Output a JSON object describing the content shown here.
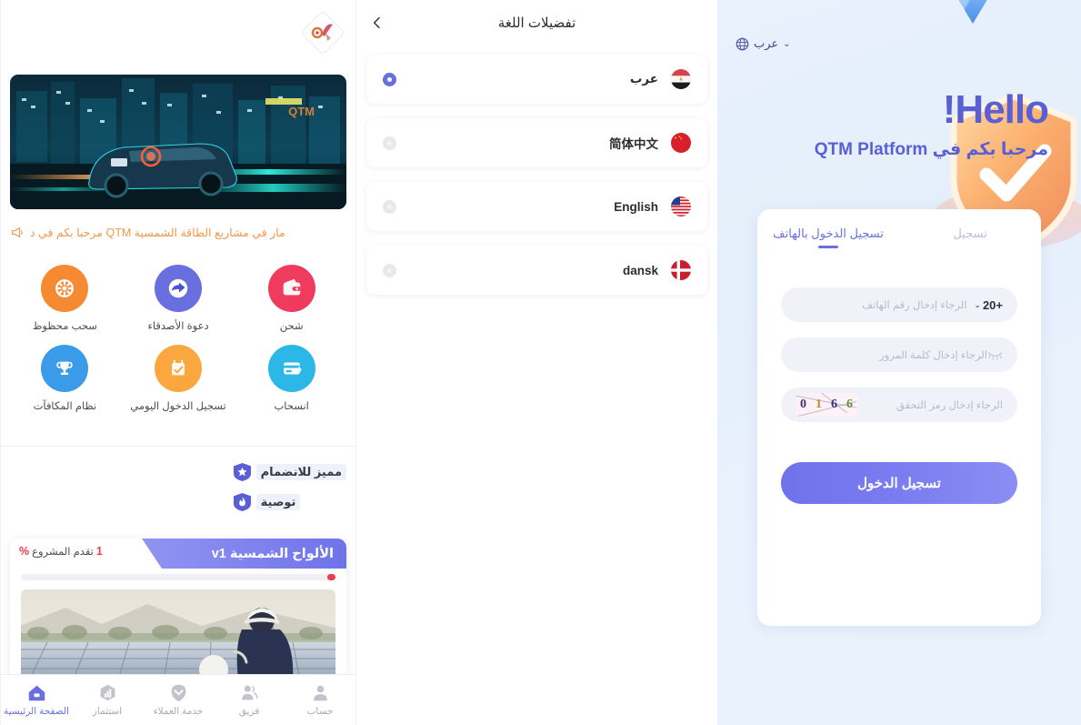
{
  "login": {
    "lang_switch": {
      "label": "عرب",
      "icon": "globe-icon",
      "chevron": "⌄"
    },
    "greeting": "Hello!",
    "welcome": "مرحبا بكم في QTM Platform",
    "tabs": [
      {
        "label": "تسجيل الدخول بالهاتف",
        "active": true
      },
      {
        "label": "تسجيل",
        "active": false
      }
    ],
    "phone": {
      "country_code": "+20",
      "placeholder": "الرجاء إدخال رقم الهاتف"
    },
    "password": {
      "placeholder": "الرجاء إدخال كلمة المرور",
      "value": "",
      "toggle_icon": "eye-closed-icon"
    },
    "captcha": {
      "placeholder": "الرجاء إدخال رمز التحقق",
      "value": "",
      "code_digits": [
        "6",
        "6",
        "1",
        "0"
      ]
    },
    "submit_label": "تسجيل الدخول"
  },
  "language_panel": {
    "title": "تفضيلات اللغة",
    "back_icon": "chevron-left-icon",
    "items": [
      {
        "name": "عرب",
        "flag": "eg",
        "selected": true
      },
      {
        "name": "简体中文",
        "flag": "cn",
        "selected": false
      },
      {
        "name": "English",
        "flag": "us",
        "selected": false
      },
      {
        "name": "dansk",
        "flag": "dk",
        "selected": false
      }
    ]
  },
  "app": {
    "logo_alt": "qtm-logo",
    "banner_alt": "electric-car-city-night-banner",
    "announcement": {
      "icon": "megaphone-icon",
      "text": "مار في مشاريع الطاقة الشمسية QTM مرحبا بكم في د",
      "color": "#f0994a"
    },
    "quick_actions": [
      {
        "label": "شحن",
        "icon": "wallet-icon",
        "color": "#ef3b5e"
      },
      {
        "label": "دعوة الأصدقاء",
        "icon": "share-arrow-icon",
        "color": "#6a6fe0"
      },
      {
        "label": "سحب محظوظ",
        "icon": "lucky-wheel-icon",
        "color": "#f58a33"
      },
      {
        "label": "انسحاب",
        "icon": "withdraw-card-icon",
        "color": "#2bb8e8"
      },
      {
        "label": "تسجيل الدخول اليومي",
        "icon": "calendar-check-icon",
        "color": "#f9a73e"
      },
      {
        "label": "نظام المكافآت",
        "icon": "trophy-icon",
        "color": "#3a9ce8"
      }
    ],
    "badges": [
      {
        "text": "مميز للانضمام",
        "icon": "star-shield-icon",
        "color": "#5a5fd6"
      },
      {
        "text": "توصية",
        "icon": "flame-shield-icon",
        "color": "#5a5fd6"
      }
    ],
    "project_card": {
      "title": "الألواح الشمسية v1",
      "progress_label": "تقدم المشروع",
      "progress_value": "1",
      "progress_symbol": "%",
      "image_alt": "solar-panel-field-worker",
      "progress_color": "#ef3b4e"
    },
    "tabbar": [
      {
        "label": "الصفحة الرئيسية",
        "icon": "home-icon",
        "active": true
      },
      {
        "label": "استثمار",
        "icon": "chart-hex-icon",
        "active": false
      },
      {
        "label": "خدمة العملاء",
        "icon": "support-icon",
        "active": false
      },
      {
        "label": "فريق",
        "icon": "team-icon",
        "active": false
      },
      {
        "label": "حساب",
        "icon": "account-icon",
        "active": false
      }
    ]
  },
  "theme": {
    "primary": "#6a6fe0",
    "accent_orange": "#f58a33",
    "danger": "#ef3b4e",
    "text_dark": "#2c2c33",
    "muted": "#b6b9cc"
  }
}
